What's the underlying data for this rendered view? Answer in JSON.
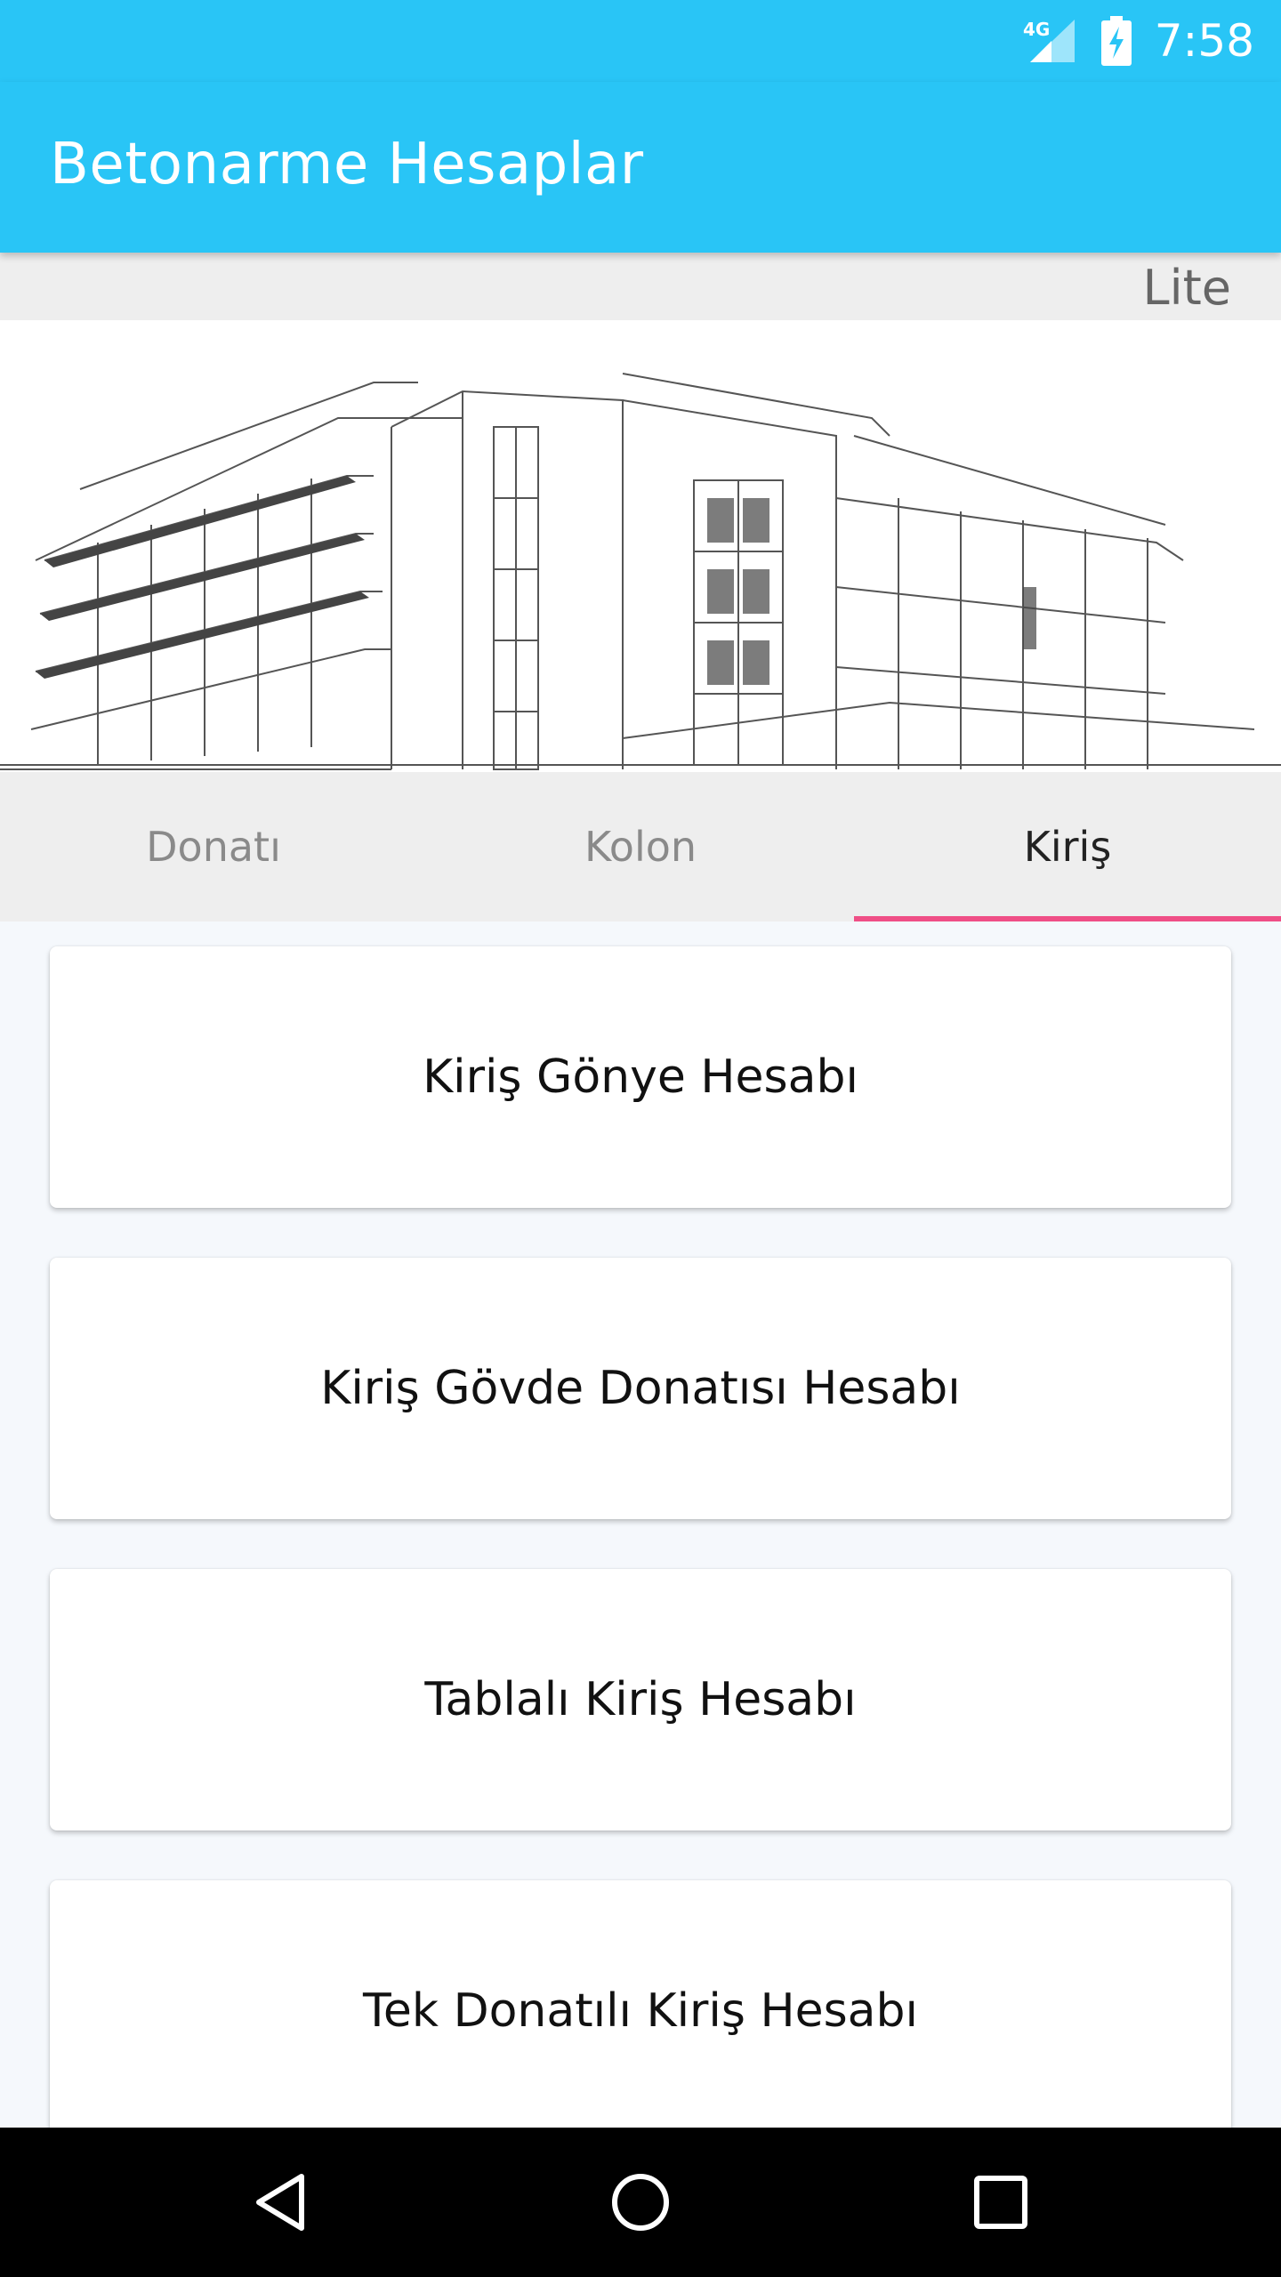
{
  "status_bar": {
    "network": "4G",
    "time": "7:58",
    "icons": [
      "signal-icon",
      "battery-charging-icon"
    ]
  },
  "app_bar": {
    "title": "Betonarme Hesaplar",
    "color": "#29c5f6"
  },
  "edition_label": "Lite",
  "hero": {
    "icon": "building-sketch-icon"
  },
  "tabs": [
    {
      "label": "Donatı",
      "active": false
    },
    {
      "label": "Kolon",
      "active": false
    },
    {
      "label": "Kiriş",
      "active": true
    }
  ],
  "accent_color": "#ef4f86",
  "cards": [
    {
      "label": "Kiriş Gönye Hesabı"
    },
    {
      "label": "Kiriş Gövde Donatısı Hesabı"
    },
    {
      "label": "Tablalı Kiriş Hesabı"
    },
    {
      "label": "Tek Donatılı Kiriş Hesabı"
    }
  ],
  "nav_bar": {
    "icons": [
      "back-icon",
      "home-icon",
      "recents-icon"
    ]
  }
}
